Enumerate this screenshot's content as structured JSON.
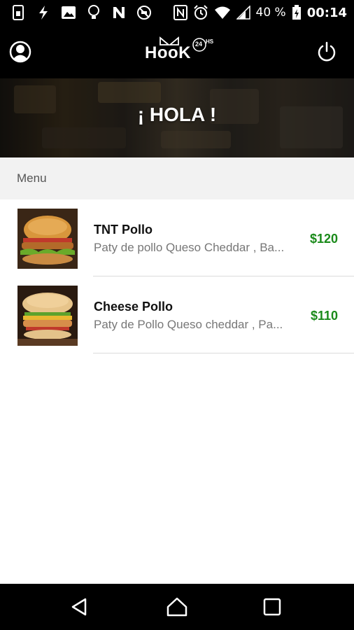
{
  "status_bar": {
    "left_icons": [
      "sim-card-icon",
      "flash-icon",
      "image-icon",
      "lightbulb-icon",
      "n-letter-icon",
      "no-data-icon"
    ],
    "right_icons": [
      "nfc-icon",
      "alarm-icon",
      "wifi-icon",
      "signal-icon"
    ],
    "battery_text": "40 %",
    "time": "00:14"
  },
  "app_bar": {
    "logo_text": "HooK",
    "logo_badge": "24",
    "logo_badge_suffix": "HS",
    "left_icon": "profile-icon",
    "right_icon": "power-icon"
  },
  "hero": {
    "title": "¡ HOLA !"
  },
  "section": {
    "title": "Menu"
  },
  "items": [
    {
      "name": "TNT Pollo",
      "description": "Paty de pollo Queso Cheddar , Ba...",
      "price": "$120"
    },
    {
      "name": "Cheese Pollo",
      "description": "Paty de Pollo Queso cheddar , Pa...",
      "price": "$110"
    }
  ],
  "colors": {
    "price": "#1a8a1a",
    "bar_background": "#000000",
    "section_background": "#f2f2f2"
  },
  "nav_bar": {
    "icons": [
      "back-icon",
      "home-icon",
      "recents-icon"
    ]
  }
}
